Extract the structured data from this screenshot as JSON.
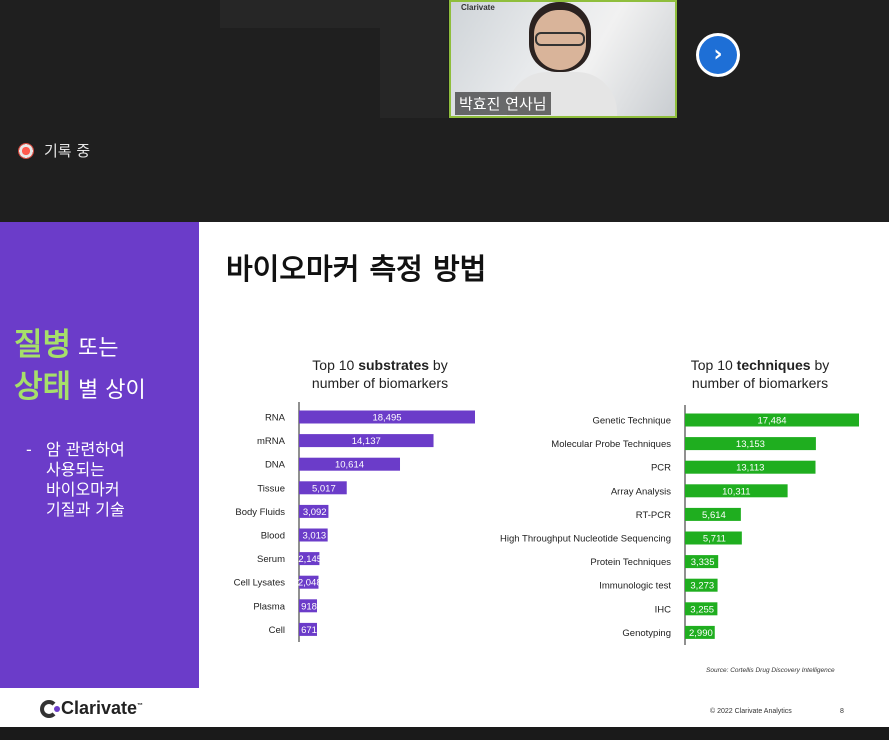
{
  "meeting": {
    "speaker_brand": "Clarivate",
    "speaker_name": "박효진 연사님",
    "next_icon": "chevron-right-icon",
    "recording_label": "기록 중",
    "accent_color": "#8fbe3c"
  },
  "slide": {
    "title": "바이오마커 측정 방법",
    "left_panel": {
      "line1_big": "질병",
      "line1_small": " 또는",
      "line2_big": "상태",
      "line2_small": " 별 상이",
      "bullet_dash": "-",
      "bullet_lines": [
        "암 관련하여",
        "사용되는",
        "바이오마커",
        "기질과 기술"
      ],
      "color": "#6b3cc9",
      "highlight_color": "#a6df6a"
    },
    "chart1_title": {
      "pre": "Top 10 ",
      "bold": "substrates",
      "post": " by",
      "line2": "number of biomarkers"
    },
    "chart2_title": {
      "pre": "Top 10 ",
      "bold": "techniques",
      "post": " by",
      "line2": "number of biomarkers"
    },
    "source": "Source: Cortellis Drug Discovery Intelligence",
    "logo_text": "Clarivate",
    "logo_tm": "™",
    "copyright": "© 2022 Clarivate Analytics",
    "page_number": "8"
  },
  "chart_data": [
    {
      "type": "bar",
      "orientation": "horizontal",
      "title": "Top 10 substrates by number of biomarkers",
      "categories": [
        "RNA",
        "mRNA",
        "DNA",
        "Tissue",
        "Body Fluids",
        "Blood",
        "Serum",
        "Cell Lysates",
        "Plasma",
        "Cell"
      ],
      "values": [
        18495,
        14137,
        10614,
        5017,
        3092,
        3013,
        2145,
        2048,
        918,
        671
      ],
      "labels": [
        "18,495",
        "14,137",
        "10,614",
        "5,017",
        "3,092",
        "3,013",
        "2,145",
        "2,048",
        "918",
        "671"
      ],
      "color": "#6b3cc9",
      "xlim": [
        0,
        18495
      ]
    },
    {
      "type": "bar",
      "orientation": "horizontal",
      "title": "Top 10 techniques by number of biomarkers",
      "categories": [
        "Genetic Technique",
        "Molecular Probe Techniques",
        "PCR",
        "Array Analysis",
        "RT-PCR",
        "High Throughput Nucleotide Sequencing",
        "Protein Techniques",
        "Immunologic test",
        "IHC",
        "Genotyping"
      ],
      "values": [
        17484,
        13153,
        13113,
        10311,
        5614,
        5711,
        3335,
        3273,
        3255,
        2990
      ],
      "labels": [
        "17,484",
        "13,153",
        "13,113",
        "10,311",
        "5,614",
        "5,711",
        "3,335",
        "3,273",
        "3,255",
        "2,990"
      ],
      "color": "#1fae1f",
      "xlim": [
        0,
        17484
      ]
    }
  ]
}
